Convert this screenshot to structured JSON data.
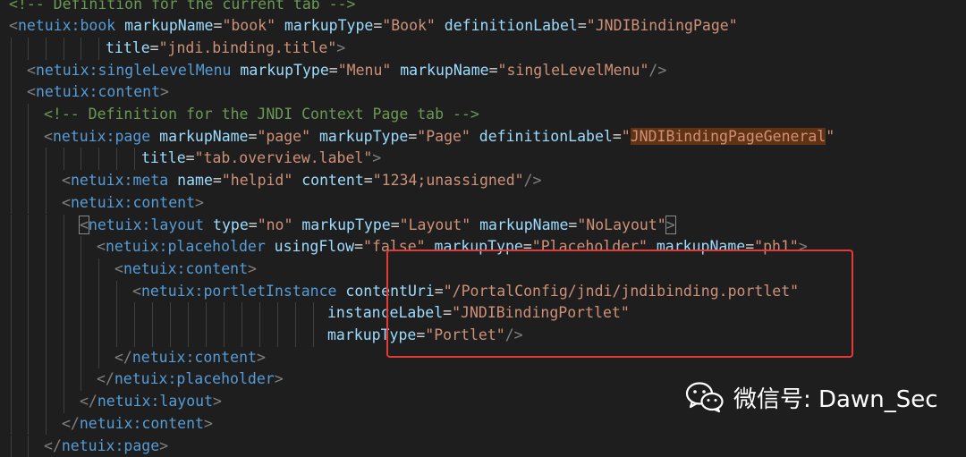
{
  "colors": {
    "background": "#1e1e1e",
    "tag": "#569cd6",
    "attribute": "#9cdcfe",
    "string": "#ce9178",
    "punctuation": "#808080",
    "comment": "#6a9955",
    "search_highlight": "#613214",
    "annotation_box": "#e53935"
  },
  "editor": {
    "lines": [
      [
        {
          "t": "<!-- Definition for the current tab -->",
          "c": "comment"
        }
      ],
      [
        {
          "t": "<",
          "c": "punct"
        },
        {
          "t": "netuix:book",
          "c": "tag"
        },
        {
          "t": " markupName",
          "c": "attr"
        },
        {
          "t": "=",
          "c": "plain"
        },
        {
          "t": "\"book\"",
          "c": "str"
        },
        {
          "t": " markupType",
          "c": "attr"
        },
        {
          "t": "=",
          "c": "plain"
        },
        {
          "t": "\"Book\"",
          "c": "str"
        },
        {
          "t": " definitionLabel",
          "c": "attr"
        },
        {
          "t": "=",
          "c": "plain"
        },
        {
          "t": "\"JNDIBindingPage\"",
          "c": "str"
        }
      ],
      [
        {
          "t": "title",
          "c": "attr"
        },
        {
          "t": "=",
          "c": "plain"
        },
        {
          "t": "\"jndi.binding.title\"",
          "c": "str"
        },
        {
          "t": ">",
          "c": "punct"
        }
      ],
      [
        {
          "t": "<",
          "c": "punct"
        },
        {
          "t": "netuix:singleLevelMenu",
          "c": "tag"
        },
        {
          "t": " markupType",
          "c": "attr"
        },
        {
          "t": "=",
          "c": "plain"
        },
        {
          "t": "\"Menu\"",
          "c": "str"
        },
        {
          "t": " markupName",
          "c": "attr"
        },
        {
          "t": "=",
          "c": "plain"
        },
        {
          "t": "\"singleLevelMenu\"",
          "c": "str"
        },
        {
          "t": "/>",
          "c": "punct"
        }
      ],
      [
        {
          "t": "<",
          "c": "punct"
        },
        {
          "t": "netuix:content",
          "c": "tag"
        },
        {
          "t": ">",
          "c": "punct"
        }
      ],
      [
        {
          "t": "<!-- Definition for the JNDI Context Page tab -->",
          "c": "comment"
        }
      ],
      [
        {
          "t": "<",
          "c": "punct"
        },
        {
          "t": "netuix:page",
          "c": "tag"
        },
        {
          "t": " markupName",
          "c": "attr"
        },
        {
          "t": "=",
          "c": "plain"
        },
        {
          "t": "\"page\"",
          "c": "str"
        },
        {
          "t": " markupType",
          "c": "attr"
        },
        {
          "t": "=",
          "c": "plain"
        },
        {
          "t": "\"Page\"",
          "c": "str"
        },
        {
          "t": " definitionLabel",
          "c": "attr"
        },
        {
          "t": "=",
          "c": "plain"
        },
        {
          "t": "\"",
          "c": "str"
        },
        {
          "t": "JNDIBindingPageGeneral",
          "c": "str",
          "hl": true
        },
        {
          "t": "\"",
          "c": "str"
        }
      ],
      [
        {
          "t": "title",
          "c": "attr"
        },
        {
          "t": "=",
          "c": "plain"
        },
        {
          "t": "\"tab.overview.label\"",
          "c": "str"
        },
        {
          "t": ">",
          "c": "punct"
        }
      ],
      [
        {
          "t": "<",
          "c": "punct"
        },
        {
          "t": "netuix:meta",
          "c": "tag"
        },
        {
          "t": " name",
          "c": "attr"
        },
        {
          "t": "=",
          "c": "plain"
        },
        {
          "t": "\"helpid\"",
          "c": "str"
        },
        {
          "t": " content",
          "c": "attr"
        },
        {
          "t": "=",
          "c": "plain"
        },
        {
          "t": "\"1234;unassigned\"",
          "c": "str"
        },
        {
          "t": "/>",
          "c": "punct"
        }
      ],
      [
        {
          "t": "<",
          "c": "punct"
        },
        {
          "t": "netuix:content",
          "c": "tag"
        },
        {
          "t": ">",
          "c": "punct"
        }
      ],
      [
        {
          "t": "<",
          "c": "punct",
          "bracket": true
        },
        {
          "t": "netuix:layout",
          "c": "tag"
        },
        {
          "t": " type",
          "c": "attr"
        },
        {
          "t": "=",
          "c": "plain"
        },
        {
          "t": "\"no\"",
          "c": "str"
        },
        {
          "t": " markupType",
          "c": "attr"
        },
        {
          "t": "=",
          "c": "plain"
        },
        {
          "t": "\"Layout\"",
          "c": "str"
        },
        {
          "t": " markupName",
          "c": "attr"
        },
        {
          "t": "=",
          "c": "plain"
        },
        {
          "t": "\"NoLayout\"",
          "c": "str"
        },
        {
          "t": ">",
          "c": "punct",
          "bracket": true
        }
      ],
      [
        {
          "t": "<",
          "c": "punct"
        },
        {
          "t": "netuix:placeholder",
          "c": "tag"
        },
        {
          "t": " usingFlow",
          "c": "attr"
        },
        {
          "t": "=",
          "c": "plain"
        },
        {
          "t": "\"false\"",
          "c": "str"
        },
        {
          "t": " markupType",
          "c": "attr"
        },
        {
          "t": "=",
          "c": "plain"
        },
        {
          "t": "\"Placeholder\"",
          "c": "str"
        },
        {
          "t": " markupName",
          "c": "attr"
        },
        {
          "t": "=",
          "c": "plain"
        },
        {
          "t": "\"ph1\"",
          "c": "str"
        },
        {
          "t": ">",
          "c": "punct"
        }
      ],
      [
        {
          "t": "<",
          "c": "punct"
        },
        {
          "t": "netuix:content",
          "c": "tag"
        },
        {
          "t": ">",
          "c": "punct"
        }
      ],
      [
        {
          "t": "<",
          "c": "punct"
        },
        {
          "t": "netuix:portletInstance",
          "c": "tag"
        },
        {
          "t": " contentUri",
          "c": "attr"
        },
        {
          "t": "=",
          "c": "plain"
        },
        {
          "t": "\"/PortalConfig/jndi/jndibinding.portlet\"",
          "c": "str"
        }
      ],
      [
        {
          "t": "instanceLabel",
          "c": "attr"
        },
        {
          "t": "=",
          "c": "plain"
        },
        {
          "t": "\"JNDIBindingPortlet\"",
          "c": "str"
        }
      ],
      [
        {
          "t": "markupType",
          "c": "attr"
        },
        {
          "t": "=",
          "c": "plain"
        },
        {
          "t": "\"Portlet\"",
          "c": "str"
        },
        {
          "t": "/>",
          "c": "punct"
        }
      ],
      [
        {
          "t": "</",
          "c": "punct"
        },
        {
          "t": "netuix:content",
          "c": "tag"
        },
        {
          "t": ">",
          "c": "punct"
        }
      ],
      [
        {
          "t": "</",
          "c": "punct"
        },
        {
          "t": "netuix:placeholder",
          "c": "tag"
        },
        {
          "t": ">",
          "c": "punct"
        }
      ],
      [
        {
          "t": "</",
          "c": "punct"
        },
        {
          "t": "netuix:layout",
          "c": "tag"
        },
        {
          "t": ">",
          "c": "punct"
        }
      ],
      [
        {
          "t": "</",
          "c": "punct"
        },
        {
          "t": "netuix:content",
          "c": "tag"
        },
        {
          "t": ">",
          "c": "punct"
        }
      ],
      [
        {
          "t": "</",
          "c": "punct"
        },
        {
          "t": "netuix:page",
          "c": "tag"
        },
        {
          "t": ">",
          "c": "punct"
        }
      ]
    ]
  },
  "watermark": {
    "icon": "wechat-icon",
    "text": "微信号: Dawn_Sec"
  }
}
